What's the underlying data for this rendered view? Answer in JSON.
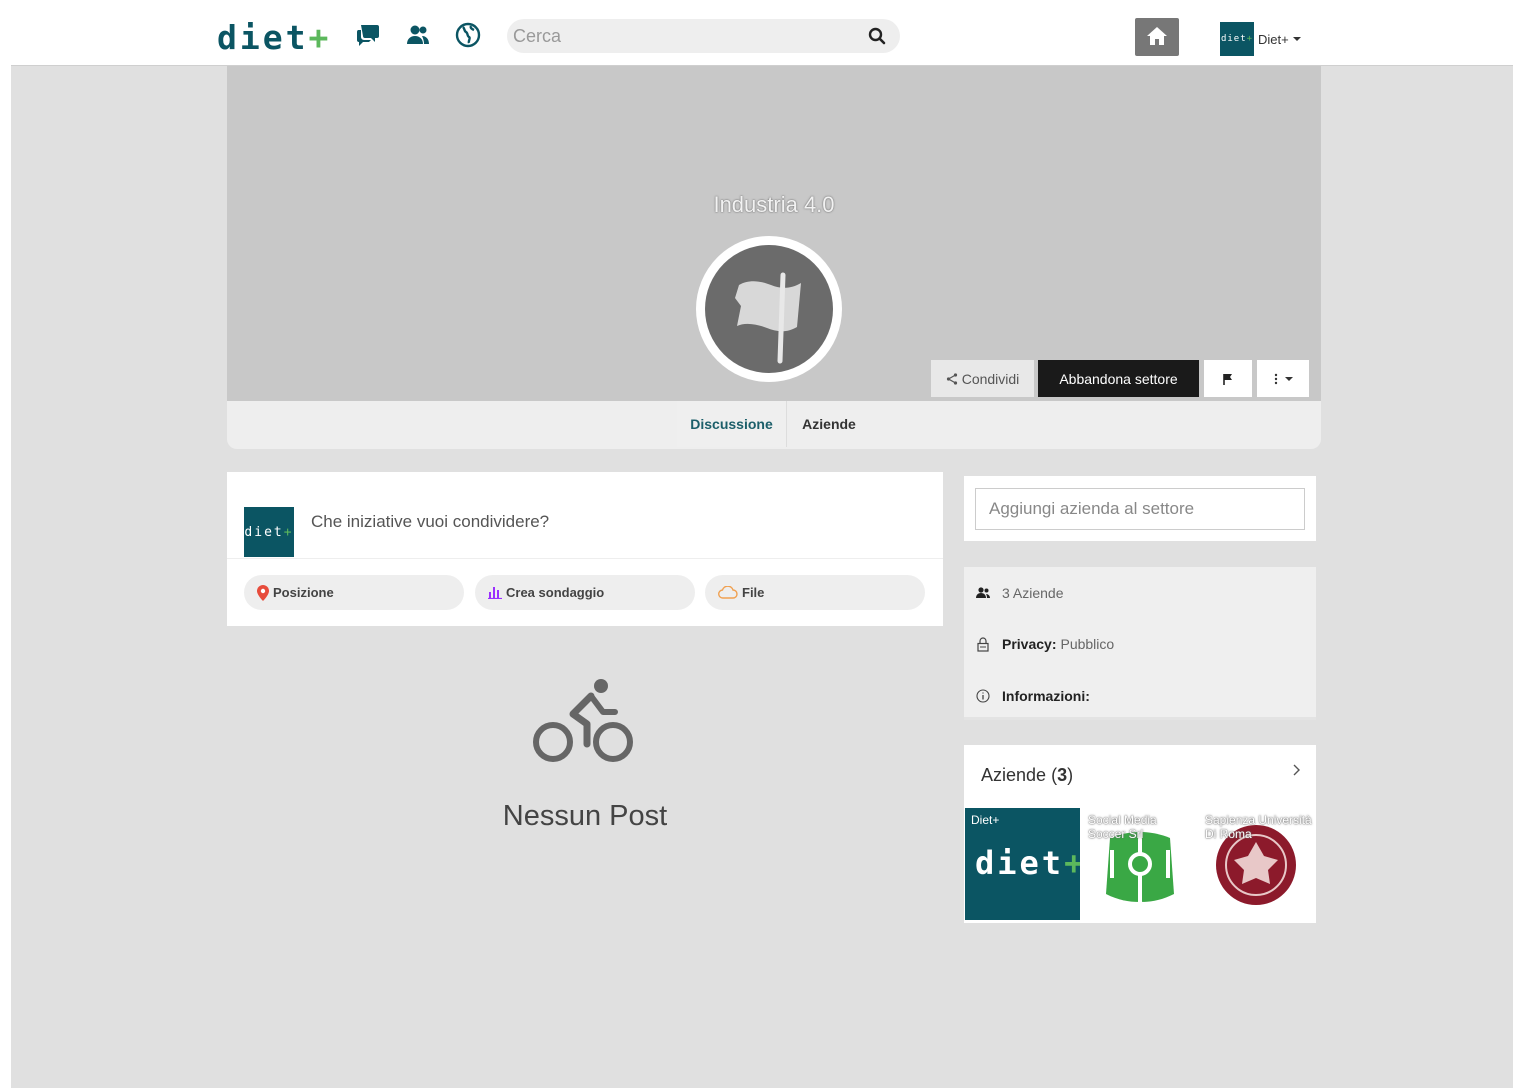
{
  "nav": {
    "brand": "diet",
    "brand_plus": "+",
    "search_placeholder": "Cerca",
    "user_label": "Diet+",
    "mini_logo": "diet",
    "mini_logo_plus": "+"
  },
  "sector": {
    "title": "Industria 4.0",
    "share_label": "Condividi",
    "leave_label": "Abbandona settore",
    "tabs": [
      {
        "label": "Discussione",
        "active": true
      },
      {
        "label": "Aziende",
        "active": false
      }
    ]
  },
  "composer": {
    "avatar_text": "diet",
    "avatar_plus": "+",
    "prompt": "Che iniziative vuoi condividere?",
    "actions": [
      {
        "label": "Posizione",
        "icon": "map-pin-icon",
        "color": "#e74c3c"
      },
      {
        "label": "Crea sondaggio",
        "icon": "poll-chart-icon",
        "color": "#9b30ff"
      },
      {
        "label": "File",
        "icon": "cloud-icon",
        "color": "#f0a050"
      }
    ]
  },
  "feed": {
    "empty_text": "Nessun Post"
  },
  "sidebar": {
    "add_placeholder": "Aggiungi azienda al settore",
    "info": {
      "members": "3 Aziende",
      "privacy_label": "Privacy:",
      "privacy_value": "Pubblico",
      "info_label": "Informazioni:"
    },
    "companies": {
      "title": "Aziende",
      "count_open": " (",
      "count": "3",
      "count_close": ")",
      "items": [
        {
          "name": "Diet+",
          "logo_text": "diet",
          "logo_plus": "+"
        },
        {
          "name": "Social Media Soccer Srl"
        },
        {
          "name": "Sapienza Università Di Roma"
        }
      ]
    }
  },
  "colors": {
    "brand": "#0b5563",
    "accent_green": "#5cb85c",
    "tab_active": "#1c5f6a"
  }
}
